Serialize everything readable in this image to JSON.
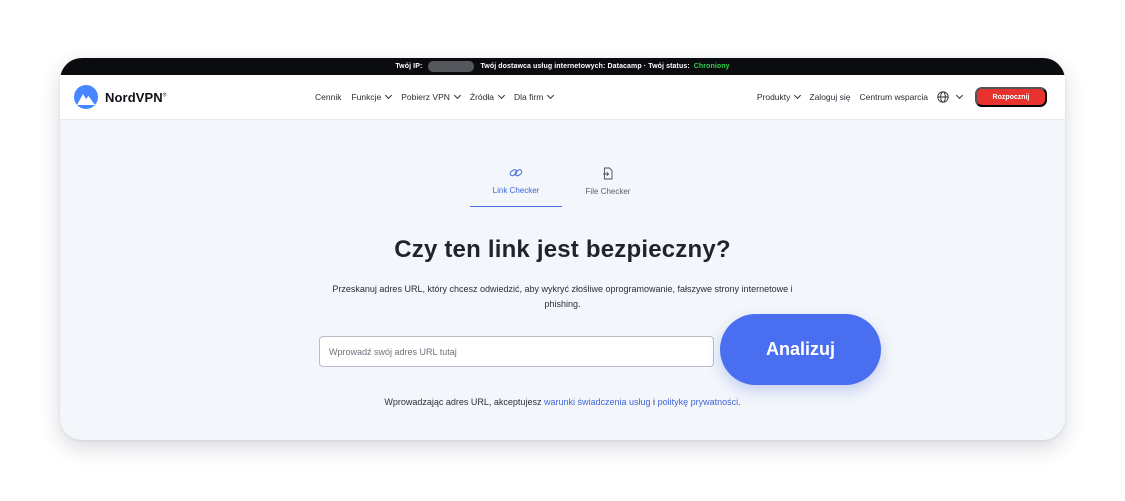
{
  "topbar": {
    "ip_label": "Twój IP:",
    "isp_text": "Twój dostawca usług internetowych: Datacamp · Twój status:",
    "status": "Chroniony",
    "status_color": "#2cd14b"
  },
  "navbar": {
    "brand": "NordVPN",
    "brand_color": "#4687ff",
    "center_items": [
      {
        "label": "Cennik"
      },
      {
        "label": "Funkcje"
      },
      {
        "label": "Pobierz VPN"
      },
      {
        "label": "Źródła"
      },
      {
        "label": "Dla firm"
      }
    ],
    "products": "Produkty",
    "login": "Zaloguj się",
    "support": "Centrum wsparcia",
    "globe_icon": "globe-icon",
    "cta": "Rozpocznij",
    "cta_color": "#e8322e"
  },
  "tabs": [
    {
      "label": "Link Checker",
      "icon": "link-icon",
      "active": true
    },
    {
      "label": "File Checker",
      "icon": "file-icon",
      "active": false
    }
  ],
  "main": {
    "headline": "Czy ten link jest bezpieczny?",
    "subtext": "Przeskanuj adres URL, który chcesz odwiedzić, aby wykryć złośliwe oprogramowanie, fałszywe strony internetowe i phishing.",
    "input_placeholder": "Wprowadź swój adres URL tutaj",
    "input_value": "",
    "button": "Analizuj",
    "button_color": "#4a6ef0"
  },
  "terms": {
    "prefix": "Wprowadzając adres URL, akceptujesz",
    "link1": "warunki świadczenia usług",
    "middle": "i",
    "link2": "politykę prywatności",
    "suffix": "."
  }
}
